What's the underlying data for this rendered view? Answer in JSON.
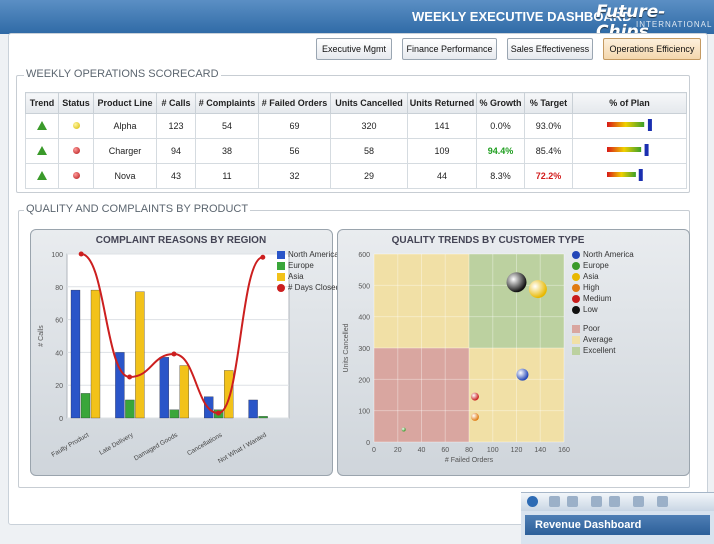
{
  "header": {
    "title": "WEEKLY EXECUTIVE DASHBOARD",
    "logo": "Future-Chips",
    "logo_sub": "INTERNATIONAL"
  },
  "nav": [
    {
      "label": "Executive Mgmt",
      "active": false
    },
    {
      "label": "Finance Performance",
      "active": false
    },
    {
      "label": "Sales Effectiveness",
      "active": false
    },
    {
      "label": "Operations Efficiency",
      "active": true
    }
  ],
  "scorecard": {
    "legend": "WEEKLY OPERATIONS SCORECARD",
    "columns": [
      "Trend",
      "Status",
      "Product Line",
      "# Calls",
      "# Complaints",
      "# Failed Orders",
      "Units Cancelled",
      "Units Returned",
      "% Growth",
      "% Target",
      "% of Plan"
    ],
    "rows": [
      {
        "status": "yellow",
        "product": "Alpha",
        "calls": "123",
        "complaints": "54",
        "failed": "69",
        "cancelled": "320",
        "returned": "141",
        "growth": "0.0%",
        "target": "93.0%",
        "plan": 0.93
      },
      {
        "status": "red",
        "product": "Charger",
        "calls": "94",
        "complaints": "38",
        "failed": "56",
        "cancelled": "58",
        "returned": "109",
        "growth": "94.4%",
        "target": "85.4%",
        "plan": 0.854
      },
      {
        "status": "red",
        "product": "Nova",
        "calls": "43",
        "complaints": "11",
        "failed": "32",
        "cancelled": "29",
        "returned": "44",
        "growth": "8.3%",
        "target": "72.2%",
        "plan": 0.722
      }
    ]
  },
  "quality": {
    "legend": "QUALITY AND COMPLAINTS BY PRODUCT"
  },
  "chart_data": [
    {
      "type": "bar",
      "title": "COMPLAINT REASONS BY REGION",
      "ylabel": "# Calls",
      "ylim": [
        0,
        100
      ],
      "yticks": [
        "0",
        "20",
        "40",
        "60",
        "80",
        "100"
      ],
      "categories": [
        "Faulty Product",
        "Late Delivery",
        "Damaged Goods",
        "Cancellations",
        "Not What I Wanted"
      ],
      "series": [
        {
          "name": "North America",
          "color": "#2a55c8",
          "values": [
            78,
            40,
            37,
            13,
            11
          ]
        },
        {
          "name": "Europe",
          "color": "#3aa63a",
          "values": [
            15,
            11,
            5,
            5,
            1
          ]
        },
        {
          "name": "Asia",
          "color": "#f2c21a",
          "values": [
            78,
            77,
            32,
            29,
            0
          ]
        }
      ],
      "line": {
        "name": "# Days Closed",
        "color": "#cc1f1f",
        "values": [
          100,
          25,
          39,
          3,
          98
        ]
      }
    },
    {
      "type": "scatter",
      "title": "QUALITY TRENDS BY CUSTOMER TYPE",
      "xlabel": "# Failed Orders",
      "ylabel": "Units Cancelled",
      "xlim": [
        0,
        160
      ],
      "ylim": [
        0,
        600
      ],
      "xticks": [
        "0",
        "20",
        "40",
        "60",
        "80",
        "100",
        "120",
        "140",
        "160"
      ],
      "yticks": [
        "0",
        "100",
        "200",
        "300",
        "400",
        "500",
        "600"
      ],
      "points": [
        {
          "x": 120,
          "y": 510,
          "color": "#111111"
        },
        {
          "x": 138,
          "y": 488,
          "color": "#e8b800"
        },
        {
          "x": 125,
          "y": 215,
          "color": "#2447b8"
        },
        {
          "x": 85,
          "y": 145,
          "color": "#c81c1c"
        },
        {
          "x": 85,
          "y": 80,
          "color": "#e07a10"
        },
        {
          "x": 25,
          "y": 40,
          "color": "#3a9a2a"
        }
      ],
      "legend": [
        {
          "label": "North America",
          "color": "#2447b8"
        },
        {
          "label": "Europe",
          "color": "#3a9a2a"
        },
        {
          "label": "Asia",
          "color": "#e8b800"
        },
        {
          "label": "High",
          "color": "#e07a10"
        },
        {
          "label": "Medium",
          "color": "#c81c1c"
        },
        {
          "label": "Low",
          "color": "#111111"
        },
        {
          "label": "Poor",
          "color": "#d9a6a0"
        },
        {
          "label": "Average",
          "color": "#f1e0a6"
        },
        {
          "label": "Excellent",
          "color": "#bcd1a0"
        }
      ]
    }
  ],
  "taskbar": {
    "item": "Revenue Dashboard"
  }
}
